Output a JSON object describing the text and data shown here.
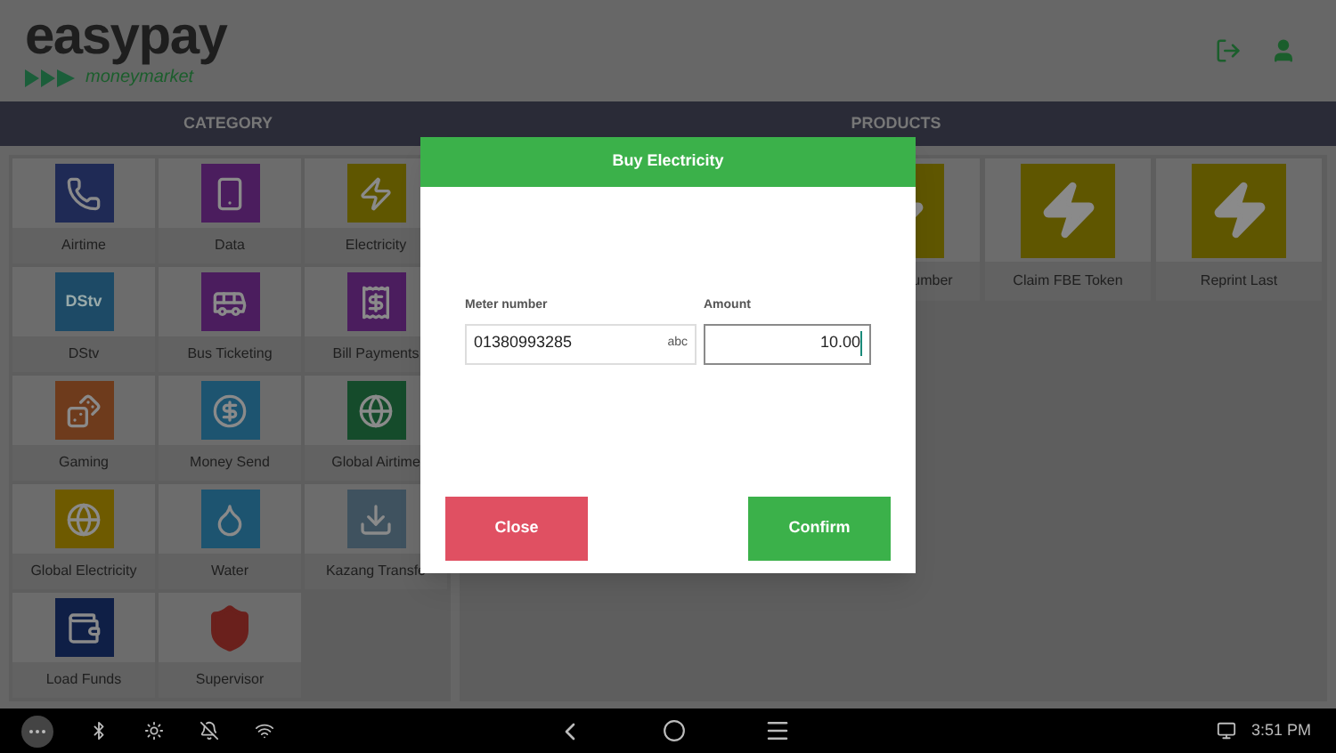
{
  "header": {
    "logo": {
      "name": "easypay",
      "tagline": "moneymarket"
    }
  },
  "category_panel": {
    "title": "CATEGORY",
    "items": [
      {
        "label": "Airtime",
        "color": "#1f2a55"
      },
      {
        "label": "Data",
        "color": "#4b1d5e"
      },
      {
        "label": "Electricity",
        "color": "#5f5600"
      },
      {
        "label": "DStv",
        "color": "#1d4a66",
        "icon_text": "DStv"
      },
      {
        "label": "Bus Ticketing",
        "color": "#4b1d5e"
      },
      {
        "label": "Bill Payments",
        "color": "#4b1d5e"
      },
      {
        "label": "Gaming",
        "color": "#6e3b1c"
      },
      {
        "label": "Money Send",
        "color": "#1d5470"
      },
      {
        "label": "Global Airtime",
        "color": "#154b2b"
      },
      {
        "label": "Global Electricity",
        "color": "#6e5a00"
      },
      {
        "label": "Water",
        "color": "#1d5470"
      },
      {
        "label": "Kazang Transfe",
        "color": "#3f525f"
      },
      {
        "label": "Load Funds",
        "color": "#0f1f46"
      },
      {
        "label": "Supervisor",
        "color": "#6a201c"
      }
    ]
  },
  "products_panel": {
    "title": "PRODUCTS",
    "items": [
      {
        "label": "umber"
      },
      {
        "label": "Claim FBE Token"
      },
      {
        "label": "Reprint Last"
      }
    ]
  },
  "dialog": {
    "title": "Buy Electricity",
    "fields": [
      {
        "label": "Meter number",
        "value": "01380993285",
        "keyboard_hint": "abc",
        "focused": false
      },
      {
        "label": "Amount",
        "value": "10.00",
        "focused": true
      }
    ],
    "buttons": [
      {
        "label": "Close",
        "kind": "cancel"
      },
      {
        "label": "Confirm",
        "kind": "confirm"
      }
    ]
  },
  "system_bar": {
    "time": "3:51 PM"
  }
}
